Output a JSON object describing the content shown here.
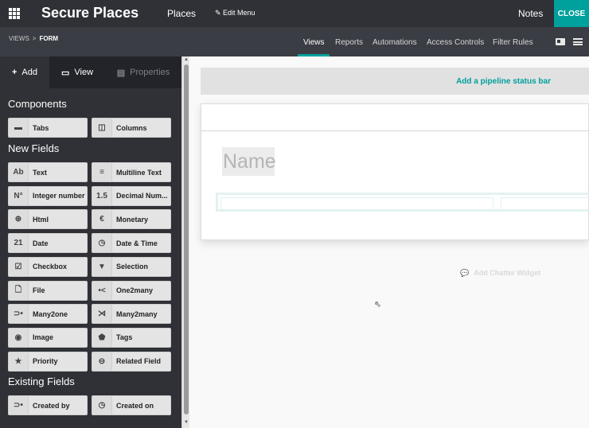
{
  "topbar": {
    "app_title": "Secure Places",
    "places": "Places",
    "edit_menu": "✎ Edit Menu",
    "notes": "Notes",
    "close": "CLOSE"
  },
  "subbar": {
    "breadcrumb_root": "VIEWS",
    "breadcrumb_sep": ">",
    "breadcrumb_current": "FORM",
    "menu": [
      "Views",
      "Reports",
      "Automations",
      "Access Controls",
      "Filter Rules"
    ],
    "active_menu": "Views"
  },
  "sidebar": {
    "tabs": {
      "add": "Add",
      "view": "View",
      "properties": "Properties"
    },
    "sections": {
      "components": "Components",
      "new_fields": "New Fields",
      "existing_fields": "Existing Fields"
    },
    "components": [
      {
        "icon": "▬",
        "label": "Tabs",
        "icon_name": "tabs-icon"
      },
      {
        "icon": "◫",
        "label": "Columns",
        "icon_name": "columns-icon"
      }
    ],
    "new_fields": [
      {
        "icon": "Ab",
        "label": "Text",
        "icon_name": "text-icon"
      },
      {
        "icon": "≡",
        "label": "Multiline Text",
        "icon_name": "multiline-icon"
      },
      {
        "icon": "N°",
        "label": "Integer number",
        "icon_name": "integer-icon"
      },
      {
        "icon": "1.5",
        "label": "Decimal Num...",
        "icon_name": "decimal-icon"
      },
      {
        "icon": "⊕",
        "label": "Html",
        "icon_name": "globe-icon"
      },
      {
        "icon": "€",
        "label": "Monetary",
        "icon_name": "euro-icon"
      },
      {
        "icon": "21",
        "label": "Date",
        "icon_name": "calendar-icon"
      },
      {
        "icon": "◷",
        "label": "Date & Time",
        "icon_name": "datetime-icon"
      },
      {
        "icon": "☑",
        "label": "Checkbox",
        "icon_name": "checkbox-icon"
      },
      {
        "icon": "▼",
        "label": "Selection",
        "icon_name": "selection-icon"
      },
      {
        "icon": "🗋",
        "label": "File",
        "icon_name": "file-icon"
      },
      {
        "icon": "•<",
        "label": "One2many",
        "icon_name": "one2many-icon"
      },
      {
        "icon": "⊃•",
        "label": "Many2one",
        "icon_name": "many2one-icon"
      },
      {
        "icon": "⋊",
        "label": "Many2many",
        "icon_name": "many2many-icon"
      },
      {
        "icon": "◉",
        "label": "Image",
        "icon_name": "camera-icon"
      },
      {
        "icon": "⬟",
        "label": "Tags",
        "icon_name": "tag-icon"
      },
      {
        "icon": "★",
        "label": "Priority",
        "icon_name": "star-icon"
      },
      {
        "icon": "⊖",
        "label": "Related Field",
        "icon_name": "link-icon"
      }
    ],
    "existing_fields": [
      {
        "icon": "⊃•",
        "label": "Created by",
        "icon_name": "many2one-icon"
      },
      {
        "icon": "◷",
        "label": "Created on",
        "icon_name": "datetime-icon"
      }
    ]
  },
  "canvas": {
    "pipeline_label": "Add a pipeline status bar",
    "name_placeholder": "Name",
    "chatter_label": "Add Chatter Widget"
  },
  "colors": {
    "accent": "#00a09d",
    "topbar": "#2f3136",
    "subbar": "#3a3d43"
  }
}
